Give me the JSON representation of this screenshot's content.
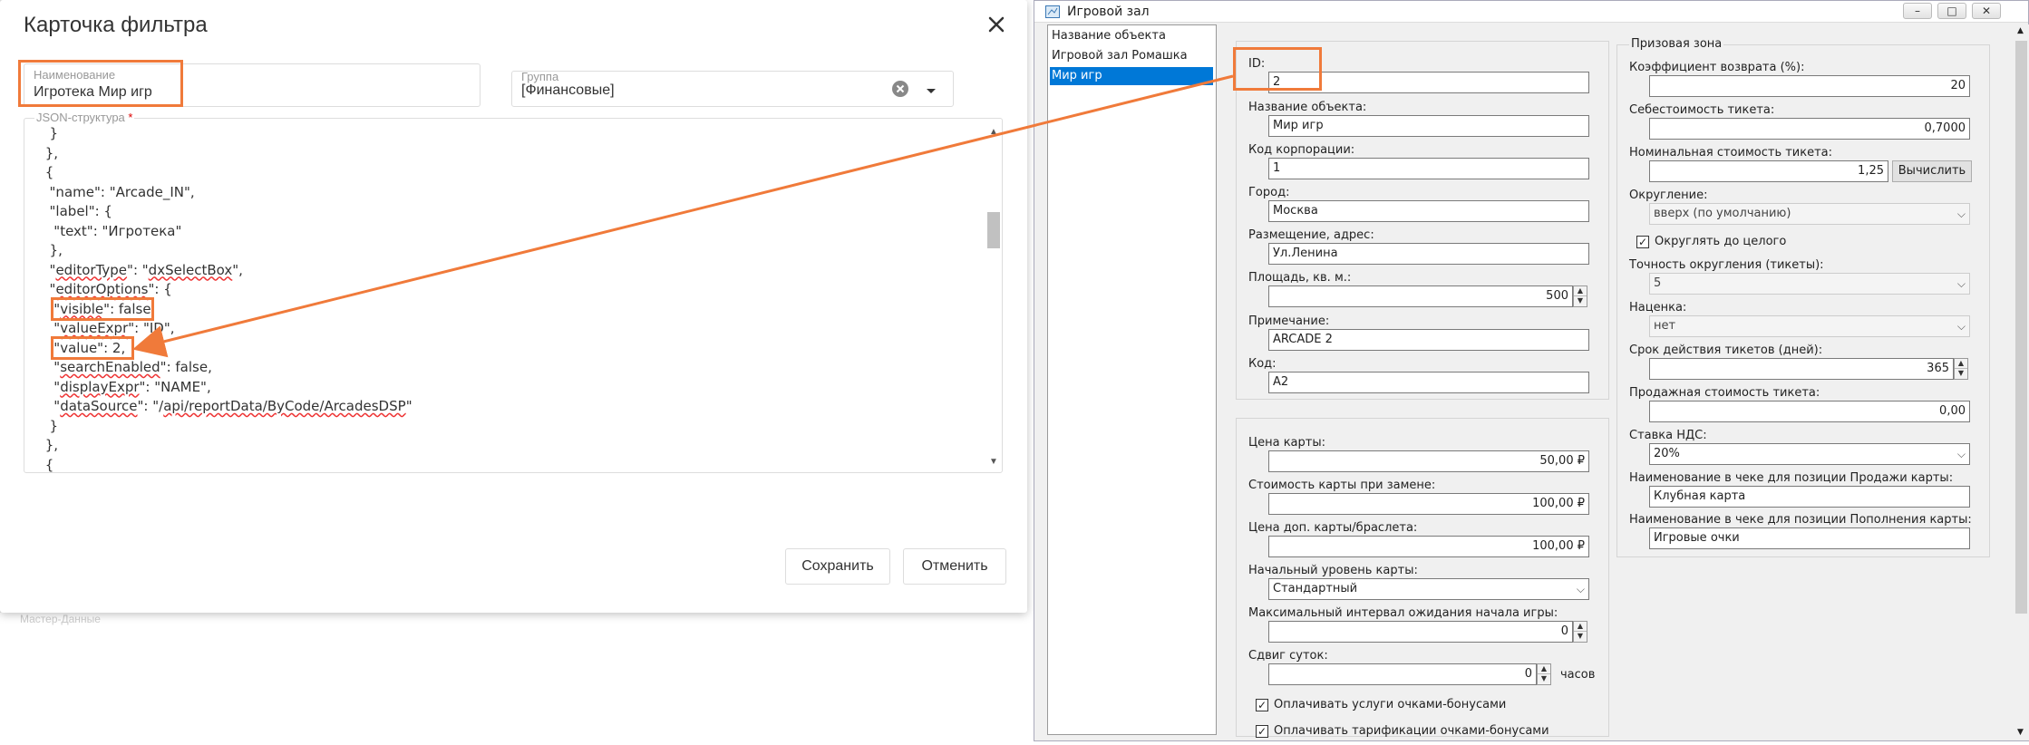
{
  "filter_card": {
    "title": "Карточка фильтра",
    "name_label": "Наименование",
    "name_value": "Игротека Мир игр",
    "group_label": "Группа",
    "group_value": "[Финансовые]",
    "json_label": "JSON-структура",
    "json_required": "*",
    "code_lines": [
      "  }",
      " },",
      " {",
      "  \"name\": \"Arcade_IN\",",
      "  \"label\": {",
      "   \"text\": \"Игротека\"",
      "  },",
      "  \"editorType\": \"dxSelectBox\",",
      "  \"editorOptions\": {",
      "   \"visible\": false,",
      "   \"valueExpr\": \"ID\",",
      "   \"value\": 2,",
      "   \"searchEnabled\": false,",
      "   \"displayExpr\": \"NAME\",",
      "   \"dataSource\": \"/api/reportData/ByCode/ArcadesDSP\"",
      "  }",
      " },",
      " {"
    ],
    "save_label": "Сохранить",
    "cancel_label": "Отменить",
    "background_text": "Мастер-Данные"
  },
  "game_hall": {
    "title": "Игровой зал",
    "list": {
      "header": "Название объекта",
      "items": [
        "Игровой зал Ромашка",
        "Мир игр"
      ],
      "selected_index": 1
    },
    "object": {
      "id_label": "ID:",
      "id_value": "2",
      "name_label": "Название объекта:",
      "name_value": "Мир игр",
      "corp_label": "Код корпорации:",
      "corp_value": "1",
      "city_label": "Город:",
      "city_value": "Москва",
      "address_label": "Размещение, адрес:",
      "address_value": "Ул.Ленина",
      "area_label": "Площадь, кв. м.:",
      "area_value": "500",
      "note_label": "Примечание:",
      "note_value": "ARCADE 2",
      "code_label": "Код:",
      "code_value": "A2"
    },
    "card": {
      "price_label": "Цена карты:",
      "price_value": "50,00 ₽",
      "replace_label": "Стоимость карты при замене:",
      "replace_value": "100,00 ₽",
      "extra_label": "Цена доп. карты/браслета:",
      "extra_value": "100,00 ₽",
      "level_label": "Начальный уровень карты:",
      "level_value": "Стандартный",
      "interval_label": "Максимальный интервал ожидания начала игры:",
      "interval_value": "0",
      "shift_label": "Сдвиг суток:",
      "shift_value": "0",
      "shift_unit": "часов",
      "pay_services_label": "Оплачивать услуги очками-бонусами",
      "pay_tariff_label": "Оплачивать тарификации очками-бонусами"
    },
    "prize": {
      "group_title": "Призовая зона",
      "return_label": "Коэффициент возврата (%):",
      "return_value": "20",
      "cost_label": "Себестоимость тикета:",
      "cost_value": "0,7000",
      "nominal_label": "Номинальная стоимость тикета:",
      "nominal_value": "1,25",
      "calc_label": "Вычислить",
      "round_label": "Округление:",
      "round_value": "вверх (по умолчанию)",
      "round_whole_label": "Округлять до целого",
      "precision_label": "Точность округления (тикеты):",
      "precision_value": "5",
      "markup_label": "Наценка:",
      "markup_value": "нет",
      "validity_label": "Срок действия тикетов (дней):",
      "validity_value": "365",
      "sale_label": "Продажная стоимость тикета:",
      "sale_value": "0,00",
      "vat_label": "Ставка НДС:",
      "vat_value": "20%",
      "receipt_sale_label": "Наименование в чеке для позиции Продажи карты:",
      "receipt_sale_value": "Клубная карта",
      "receipt_topup_label": "Наименование в чеке для позиции Пополнения карты:",
      "receipt_topup_value": "Игровые очки"
    }
  },
  "colors": {
    "annotation": "#f07a3a",
    "selection": "#0078d7"
  }
}
